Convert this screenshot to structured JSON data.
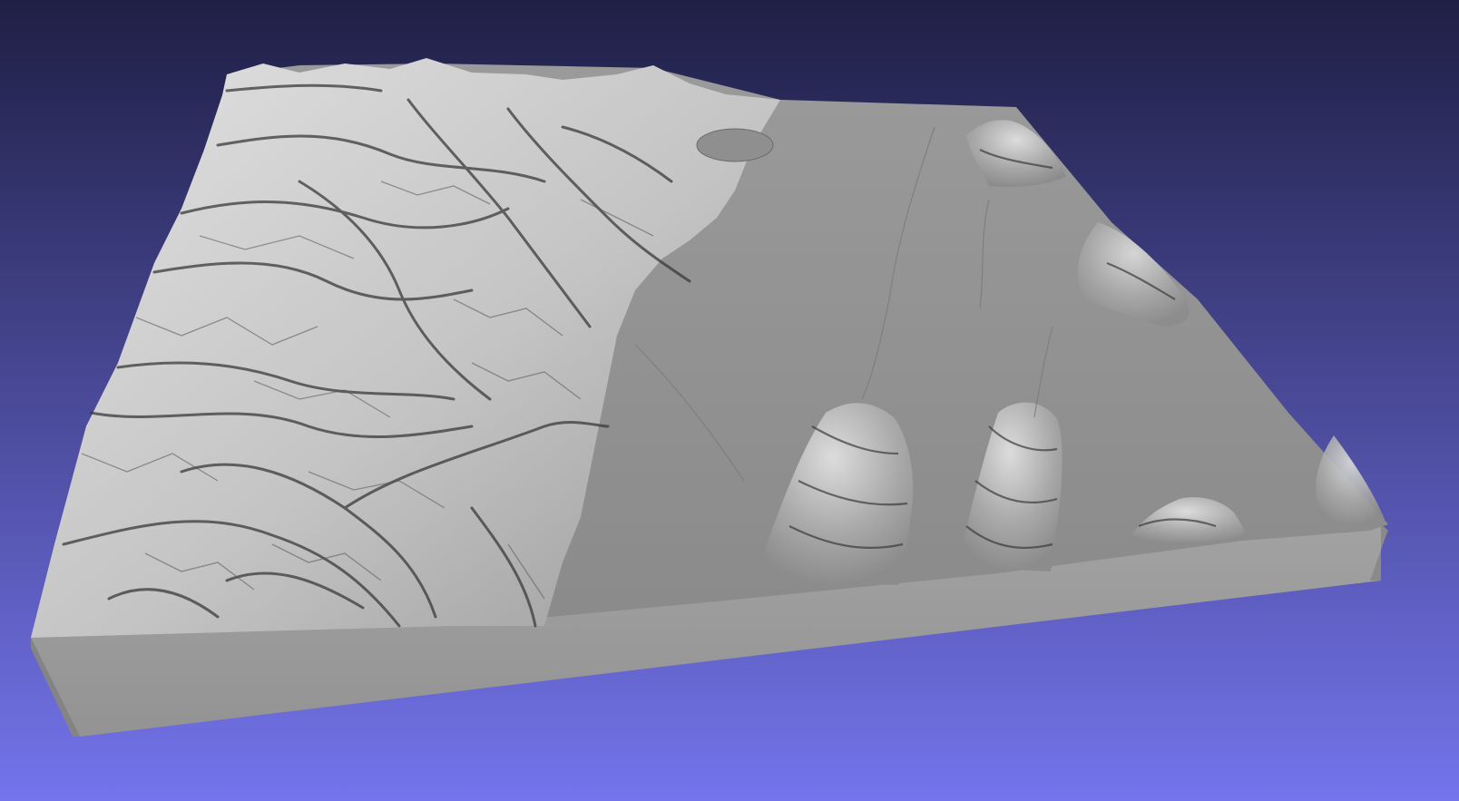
{
  "viewport": {
    "background_top": "#1f1f45",
    "background_bottom": "#7474ec"
  },
  "terrain": {
    "surface_color": "#8e8e8e",
    "mountain_light": "#d9d9d9",
    "shadow_color": "#2e2e2e",
    "side_color": "#9b9b9b",
    "side_shadow": "#8a8a8a"
  }
}
